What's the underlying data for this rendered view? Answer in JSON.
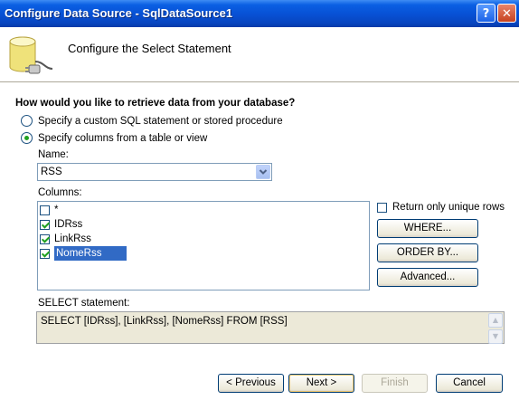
{
  "window": {
    "title": "Configure Data Source - SqlDataSource1",
    "help_label": "?",
    "close_label": "✕"
  },
  "header": {
    "title": "Configure the Select Statement",
    "icon": "database-plug-icon"
  },
  "main": {
    "question": "How would you like to retrieve data from your database?",
    "options": [
      {
        "label": "Specify a custom SQL statement or stored procedure",
        "selected": false
      },
      {
        "label": "Specify columns from a table or view",
        "selected": true
      }
    ],
    "name_label": "Name:",
    "name_value": "RSS",
    "columns_label": "Columns:",
    "columns": [
      {
        "label": "*",
        "checked": false
      },
      {
        "label": "IDRss",
        "checked": true
      },
      {
        "label": "LinkRss",
        "checked": true
      },
      {
        "label": "NomeRss",
        "checked": true,
        "selected": true
      }
    ],
    "unique_rows_label": "Return only unique rows",
    "unique_rows_checked": false,
    "where_button": "WHERE...",
    "orderby_button": "ORDER BY...",
    "advanced_button": "Advanced...",
    "select_statement_label": "SELECT statement:",
    "select_statement": "SELECT [IDRss], [LinkRss], [NomeRss] FROM [RSS]"
  },
  "footer": {
    "previous": "< Previous",
    "next": "Next >",
    "finish": "Finish",
    "cancel": "Cancel"
  }
}
